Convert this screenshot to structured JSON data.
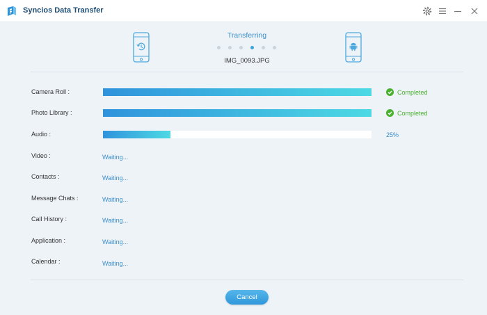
{
  "app": {
    "title": "Syncios Data Transfer"
  },
  "window_controls": [
    "gear-icon",
    "menu-icon",
    "minimize-icon",
    "close-icon"
  ],
  "transfer": {
    "status_title": "Transferring",
    "current_file": "IMG_0093.JPG",
    "progress_dots": 6,
    "active_dot": 4,
    "source_device": "ios-restore-phone-icon",
    "target_device": "android-phone-icon"
  },
  "items": [
    {
      "label": "Camera Roll :",
      "state": "completed",
      "progress": 1.0,
      "status": "Completed"
    },
    {
      "label": "Photo Library :",
      "state": "completed",
      "progress": 1.0,
      "status": "Completed"
    },
    {
      "label": "Audio :",
      "state": "in_progress",
      "progress": 0.25,
      "status": "25%"
    },
    {
      "label": "Video :",
      "state": "waiting",
      "status": "Waiting..."
    },
    {
      "label": "Contacts :",
      "state": "waiting",
      "status": "Waiting..."
    },
    {
      "label": "Message Chats :",
      "state": "waiting",
      "status": "Waiting..."
    },
    {
      "label": "Call History :",
      "state": "waiting",
      "status": "Waiting..."
    },
    {
      "label": "Application :",
      "state": "waiting",
      "status": "Waiting..."
    },
    {
      "label": "Calendar :",
      "state": "waiting",
      "status": "Waiting..."
    }
  ],
  "actions": {
    "cancel_label": "Cancel"
  },
  "colors": {
    "accent": "#3d8ec7",
    "success": "#4ab12f",
    "bar_start": "#2f93dc",
    "bar_end": "#4dd9e4",
    "background": "#eef3f8"
  }
}
